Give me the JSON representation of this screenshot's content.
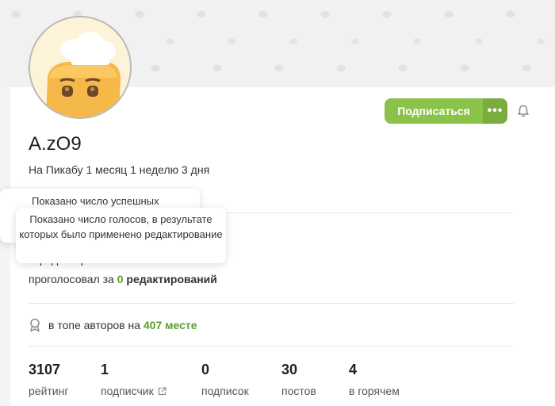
{
  "profile": {
    "username": "A.zO9",
    "since": "На Пикабу 1 месяц 1 неделю 3 дня"
  },
  "actions": {
    "subscribe_label": "Подписаться",
    "more_label": "•••"
  },
  "edits": {
    "hidden_text": "Д     б",
    "edited_text": "отредактировал",
    "voted_prefix": "проголосовал за ",
    "voted_count": "0",
    "voted_suffix": " редактирований"
  },
  "tooltips": {
    "first": "Показано число успешных",
    "second": "Показано число голосов, в результате которых было применено редактирование"
  },
  "top": {
    "prefix": "в топе авторов на ",
    "place": "407 месте"
  },
  "stats": [
    {
      "value": "3107",
      "label": "рейтинг"
    },
    {
      "value": "1",
      "label": "подписчик"
    },
    {
      "value": "0",
      "label": "подписок"
    },
    {
      "value": "30",
      "label": "постов"
    },
    {
      "value": "4",
      "label": "в горячем"
    }
  ],
  "colors": {
    "accent": "#8bc34a",
    "accent_dark": "#79ad3f",
    "highlight": "#5aa02c"
  }
}
